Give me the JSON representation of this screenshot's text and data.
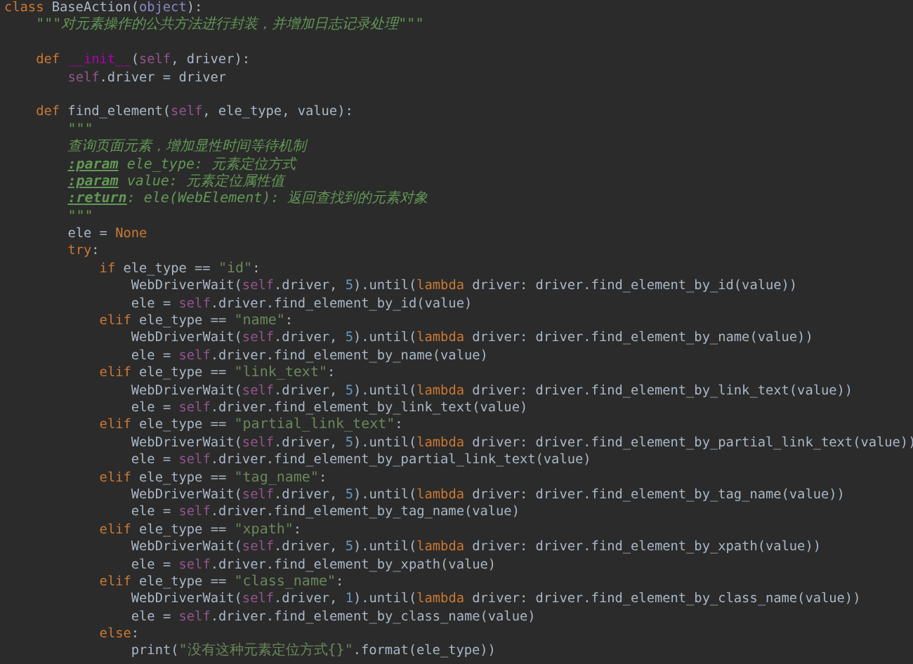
{
  "code": [
    {
      "tokens": [
        {
          "kind": "keyword",
          "text": "class "
        },
        {
          "kind": "plain",
          "text": "BaseAction("
        },
        {
          "kind": "builtin",
          "text": "object"
        },
        {
          "kind": "plain",
          "text": "):"
        }
      ],
      "children": [
        {
          "tokens": [
            {
              "kind": "doc",
              "text": "\"\"\"对元素操作的公共方法进行封装，并增加日志记录处理\"\"\""
            }
          ]
        },
        {
          "kind": "blank"
        },
        {
          "tokens": [
            {
              "kind": "keyword",
              "text": "def "
            },
            {
              "kind": "magic",
              "text": "__init__"
            },
            {
              "kind": "plain",
              "text": "("
            },
            {
              "kind": "self",
              "text": "self"
            },
            {
              "kind": "plain",
              "text": ", driver):"
            }
          ],
          "children": [
            {
              "tokens": [
                {
                  "kind": "self",
                  "text": "self"
                },
                {
                  "kind": "plain",
                  "text": ".driver = driver"
                }
              ]
            }
          ]
        },
        {
          "kind": "blank"
        },
        {
          "tokens": [
            {
              "kind": "keyword",
              "text": "def "
            },
            {
              "kind": "plain",
              "text": "find_element("
            },
            {
              "kind": "self",
              "text": "self"
            },
            {
              "kind": "plain",
              "text": ", ele_type, value):"
            }
          ],
          "children": [
            {
              "tokens": [
                {
                  "kind": "doc",
                  "text": "\"\"\""
                }
              ]
            },
            {
              "tokens": [
                {
                  "kind": "doc",
                  "text": "查询页面元素，增加显性时间等待机制"
                }
              ]
            },
            {
              "tokens": [
                {
                  "kind": "doc",
                  "text": "**:param** ele_type: 元素定位方式"
                }
              ]
            },
            {
              "tokens": [
                {
                  "kind": "doc",
                  "text": "**:param** value: 元素定位属性值"
                }
              ]
            },
            {
              "tokens": [
                {
                  "kind": "doc",
                  "text": "**:return**: ele(WebElement): 返回查找到的元素对象"
                }
              ]
            },
            {
              "tokens": [
                {
                  "kind": "doc",
                  "text": "\"\"\""
                }
              ]
            },
            {
              "tokens": [
                {
                  "kind": "plain",
                  "text": "ele = "
                },
                {
                  "kind": "keyword",
                  "text": "None"
                }
              ]
            },
            {
              "tokens": [
                {
                  "kind": "keyword",
                  "text": "try"
                },
                {
                  "kind": "plain",
                  "text": ":"
                }
              ],
              "children": [
                {
                  "tokens": [
                    {
                      "kind": "keyword",
                      "text": "if "
                    },
                    {
                      "kind": "plain",
                      "text": "ele_type == "
                    },
                    {
                      "kind": "string",
                      "text": "\"id\""
                    },
                    {
                      "kind": "plain",
                      "text": ":"
                    }
                  ],
                  "children": [
                    {
                      "tokens": [
                        {
                          "kind": "plain",
                          "text": "WebDriverWait("
                        },
                        {
                          "kind": "self",
                          "text": "self"
                        },
                        {
                          "kind": "plain",
                          "text": ".driver, "
                        },
                        {
                          "kind": "number",
                          "text": "5"
                        },
                        {
                          "kind": "plain",
                          "text": ").until("
                        },
                        {
                          "kind": "keyword",
                          "text": "lambda "
                        },
                        {
                          "kind": "plain",
                          "text": "driver: driver.find_element_by_id(value))"
                        }
                      ]
                    },
                    {
                      "tokens": [
                        {
                          "kind": "plain",
                          "text": "ele = "
                        },
                        {
                          "kind": "self",
                          "text": "self"
                        },
                        {
                          "kind": "plain",
                          "text": ".driver.find_element_by_id(value)"
                        }
                      ]
                    }
                  ]
                },
                {
                  "tokens": [
                    {
                      "kind": "keyword",
                      "text": "elif "
                    },
                    {
                      "kind": "plain",
                      "text": "ele_type == "
                    },
                    {
                      "kind": "string",
                      "text": "\"name\""
                    },
                    {
                      "kind": "plain",
                      "text": ":"
                    }
                  ],
                  "children": [
                    {
                      "tokens": [
                        {
                          "kind": "plain",
                          "text": "WebDriverWait("
                        },
                        {
                          "kind": "self",
                          "text": "self"
                        },
                        {
                          "kind": "plain",
                          "text": ".driver, "
                        },
                        {
                          "kind": "number",
                          "text": "5"
                        },
                        {
                          "kind": "plain",
                          "text": ").until("
                        },
                        {
                          "kind": "keyword",
                          "text": "lambda "
                        },
                        {
                          "kind": "plain",
                          "text": "driver: driver.find_element_by_name(value))"
                        }
                      ]
                    },
                    {
                      "tokens": [
                        {
                          "kind": "plain",
                          "text": "ele = "
                        },
                        {
                          "kind": "self",
                          "text": "self"
                        },
                        {
                          "kind": "plain",
                          "text": ".driver.find_element_by_name(value)"
                        }
                      ]
                    }
                  ]
                },
                {
                  "tokens": [
                    {
                      "kind": "keyword",
                      "text": "elif "
                    },
                    {
                      "kind": "plain",
                      "text": "ele_type == "
                    },
                    {
                      "kind": "string",
                      "text": "\"link_text\""
                    },
                    {
                      "kind": "plain",
                      "text": ":"
                    }
                  ],
                  "children": [
                    {
                      "tokens": [
                        {
                          "kind": "plain",
                          "text": "WebDriverWait("
                        },
                        {
                          "kind": "self",
                          "text": "self"
                        },
                        {
                          "kind": "plain",
                          "text": ".driver, "
                        },
                        {
                          "kind": "number",
                          "text": "5"
                        },
                        {
                          "kind": "plain",
                          "text": ").until("
                        },
                        {
                          "kind": "keyword",
                          "text": "lambda "
                        },
                        {
                          "kind": "plain",
                          "text": "driver: driver.find_element_by_link_text(value))"
                        }
                      ]
                    },
                    {
                      "tokens": [
                        {
                          "kind": "plain",
                          "text": "ele = "
                        },
                        {
                          "kind": "self",
                          "text": "self"
                        },
                        {
                          "kind": "plain",
                          "text": ".driver.find_element_by_link_text(value)"
                        }
                      ]
                    }
                  ]
                },
                {
                  "tokens": [
                    {
                      "kind": "keyword",
                      "text": "elif "
                    },
                    {
                      "kind": "plain",
                      "text": "ele_type == "
                    },
                    {
                      "kind": "string",
                      "text": "\"partial_link_text\""
                    },
                    {
                      "kind": "plain",
                      "text": ":"
                    }
                  ],
                  "children": [
                    {
                      "tokens": [
                        {
                          "kind": "plain",
                          "text": "WebDriverWait("
                        },
                        {
                          "kind": "self",
                          "text": "self"
                        },
                        {
                          "kind": "plain",
                          "text": ".driver, "
                        },
                        {
                          "kind": "number",
                          "text": "5"
                        },
                        {
                          "kind": "plain",
                          "text": ").until("
                        },
                        {
                          "kind": "keyword",
                          "text": "lambda "
                        },
                        {
                          "kind": "plain",
                          "text": "driver: driver.find_element_by_partial_link_text(value))"
                        }
                      ]
                    },
                    {
                      "tokens": [
                        {
                          "kind": "plain",
                          "text": "ele = "
                        },
                        {
                          "kind": "self",
                          "text": "self"
                        },
                        {
                          "kind": "plain",
                          "text": ".driver.find_element_by_partial_link_text(value)"
                        }
                      ]
                    }
                  ]
                },
                {
                  "tokens": [
                    {
                      "kind": "keyword",
                      "text": "elif "
                    },
                    {
                      "kind": "plain",
                      "text": "ele_type == "
                    },
                    {
                      "kind": "string",
                      "text": "\"tag_name\""
                    },
                    {
                      "kind": "plain",
                      "text": ":"
                    }
                  ],
                  "children": [
                    {
                      "tokens": [
                        {
                          "kind": "plain",
                          "text": "WebDriverWait("
                        },
                        {
                          "kind": "self",
                          "text": "self"
                        },
                        {
                          "kind": "plain",
                          "text": ".driver, "
                        },
                        {
                          "kind": "number",
                          "text": "5"
                        },
                        {
                          "kind": "plain",
                          "text": ").until("
                        },
                        {
                          "kind": "keyword",
                          "text": "lambda "
                        },
                        {
                          "kind": "plain",
                          "text": "driver: driver.find_element_by_tag_name(value))"
                        }
                      ]
                    },
                    {
                      "tokens": [
                        {
                          "kind": "plain",
                          "text": "ele = "
                        },
                        {
                          "kind": "self",
                          "text": "self"
                        },
                        {
                          "kind": "plain",
                          "text": ".driver.find_element_by_tag_name(value)"
                        }
                      ]
                    }
                  ]
                },
                {
                  "tokens": [
                    {
                      "kind": "keyword",
                      "text": "elif "
                    },
                    {
                      "kind": "plain",
                      "text": "ele_type == "
                    },
                    {
                      "kind": "string",
                      "text": "\"xpath\""
                    },
                    {
                      "kind": "plain",
                      "text": ":"
                    }
                  ],
                  "children": [
                    {
                      "tokens": [
                        {
                          "kind": "plain",
                          "text": "WebDriverWait("
                        },
                        {
                          "kind": "self",
                          "text": "self"
                        },
                        {
                          "kind": "plain",
                          "text": ".driver, "
                        },
                        {
                          "kind": "number",
                          "text": "5"
                        },
                        {
                          "kind": "plain",
                          "text": ").until("
                        },
                        {
                          "kind": "keyword",
                          "text": "lambda "
                        },
                        {
                          "kind": "plain",
                          "text": "driver: driver.find_element_by_xpath(value))"
                        }
                      ]
                    },
                    {
                      "tokens": [
                        {
                          "kind": "plain",
                          "text": "ele = "
                        },
                        {
                          "kind": "self",
                          "text": "self"
                        },
                        {
                          "kind": "plain",
                          "text": ".driver.find_element_by_xpath(value)"
                        }
                      ]
                    }
                  ]
                },
                {
                  "tokens": [
                    {
                      "kind": "keyword",
                      "text": "elif "
                    },
                    {
                      "kind": "plain",
                      "text": "ele_type == "
                    },
                    {
                      "kind": "string",
                      "text": "\"class_name\""
                    },
                    {
                      "kind": "plain",
                      "text": ":"
                    }
                  ],
                  "children": [
                    {
                      "tokens": [
                        {
                          "kind": "plain",
                          "text": "WebDriverWait("
                        },
                        {
                          "kind": "self",
                          "text": "self"
                        },
                        {
                          "kind": "plain",
                          "text": ".driver, "
                        },
                        {
                          "kind": "number",
                          "text": "1"
                        },
                        {
                          "kind": "plain",
                          "text": ").until("
                        },
                        {
                          "kind": "keyword",
                          "text": "lambda "
                        },
                        {
                          "kind": "plain",
                          "text": "driver: driver.find_element_by_class_name(value))"
                        }
                      ]
                    },
                    {
                      "tokens": [
                        {
                          "kind": "plain",
                          "text": "ele = "
                        },
                        {
                          "kind": "self",
                          "text": "self"
                        },
                        {
                          "kind": "plain",
                          "text": ".driver.find_element_by_class_name(value)"
                        }
                      ]
                    }
                  ]
                },
                {
                  "tokens": [
                    {
                      "kind": "keyword",
                      "text": "else"
                    },
                    {
                      "kind": "plain",
                      "text": ":"
                    }
                  ],
                  "children": [
                    {
                      "tokens": [
                        {
                          "kind": "plain",
                          "text": "print("
                        },
                        {
                          "kind": "string",
                          "text": "\"没有这种元素定位方式{}\""
                        },
                        {
                          "kind": "plain",
                          "text": ".format(ele_type))"
                        }
                      ]
                    }
                  ]
                }
              ]
            }
          ]
        }
      ]
    }
  ]
}
